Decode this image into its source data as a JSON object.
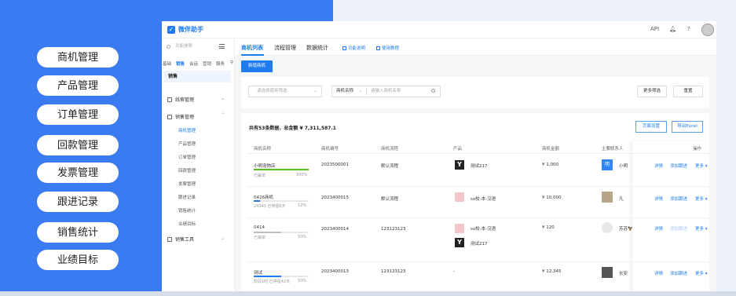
{
  "left_menu": [
    "商机管理",
    "产品管理",
    "订单管理",
    "回款管理",
    "发票管理",
    "跟进记录",
    "销售统计",
    "业绩目标"
  ],
  "app": {
    "title": "微伴助手",
    "top_right": {
      "api": "API"
    }
  },
  "sidebar": {
    "search_placeholder": "功能搜索",
    "tabs": [
      "基础",
      "销售",
      "会话",
      "营销",
      "服务"
    ],
    "section": "销售",
    "groups": [
      {
        "label": "线索管理"
      },
      {
        "label": "销售管理",
        "items": [
          "商机管理",
          "产品管理",
          "订单管理",
          "回款管理",
          "发票管理",
          "跟进记录",
          "销售统计",
          "业绩目标"
        ]
      },
      {
        "label": "销售工具"
      }
    ]
  },
  "main": {
    "tabs": [
      "商机列表",
      "流程管理",
      "数据统计"
    ],
    "links": [
      "功能说明",
      "使用教程"
    ],
    "new_button": "新增商机",
    "filter": {
      "select_placeholder": "请选择使用筛选",
      "field_label": "商机名称",
      "field_placeholder": "请输入商机名称",
      "more": "更多筛选",
      "reset": "重置"
    },
    "summary": "共有53条数据，总金额 ¥ 7,311,587.1",
    "page_settings": "页面设置",
    "export": "导出Excel",
    "columns": [
      "商机名称",
      "商机编号",
      "商机流程",
      "产品",
      "商机金额",
      "主要联系人",
      "操作"
    ],
    "rows": [
      {
        "name": "小明宠物店",
        "status": "已赢单",
        "percent": "100%",
        "progress": 1.0,
        "bar_color": "#52c41a",
        "number": "2023500001",
        "flow": "默认流程",
        "products": [
          {
            "thumb": "dark",
            "name": "测试217"
          }
        ],
        "amount": "¥ 1,000",
        "contact": {
          "avatar": "明",
          "avatar_style": "blue",
          "name": "小明"
        },
        "actions": [
          "详情",
          "添加跟进",
          "更多 ▾"
        ]
      },
      {
        "name": "0426商机",
        "status": "24343 已停留6天",
        "percent": "12%",
        "progress": 0.12,
        "bar_color": "#1f7cf0",
        "number": "2023400015",
        "flow": "默认流程",
        "products": [
          {
            "thumb": "pink",
            "name": "sx校-本-汉语"
          }
        ],
        "amount": "¥ 10,000",
        "contact": {
          "avatar": "",
          "avatar_style": "photo",
          "name": "凡"
        },
        "actions": [
          "详情",
          "添加跟进",
          "更多 ▾"
        ]
      },
      {
        "name": "0414",
        "status": "已输单",
        "percent": "50%",
        "progress": 0.5,
        "bar_color": "#bfbfbf",
        "number": "2023400014",
        "flow": "123123123",
        "products": [
          {
            "thumb": "pink",
            "name": "sx校-本-汉语"
          },
          {
            "thumb": "dark",
            "name": "测试217"
          }
        ],
        "amount": "¥ 120",
        "contact": {
          "avatar": "",
          "avatar_style": "light",
          "name": "苏苏🦅"
        },
        "actions": [
          "详情",
          "添加跟进",
          "更多 ▾"
        ]
      },
      {
        "name": "测试",
        "status": "阶段1时 已停留42天",
        "percent": "50%",
        "progress": 0.5,
        "bar_color": "#1f7cf0",
        "number": "2023400013",
        "flow": "123123123",
        "products": [
          {
            "thumb": "none",
            "name": "-"
          }
        ],
        "amount": "¥ 12,345",
        "contact": {
          "avatar": "",
          "avatar_style": "dark",
          "name": "长安"
        },
        "actions": [
          "详情",
          "添加跟进",
          "更多 ▾"
        ]
      }
    ]
  }
}
